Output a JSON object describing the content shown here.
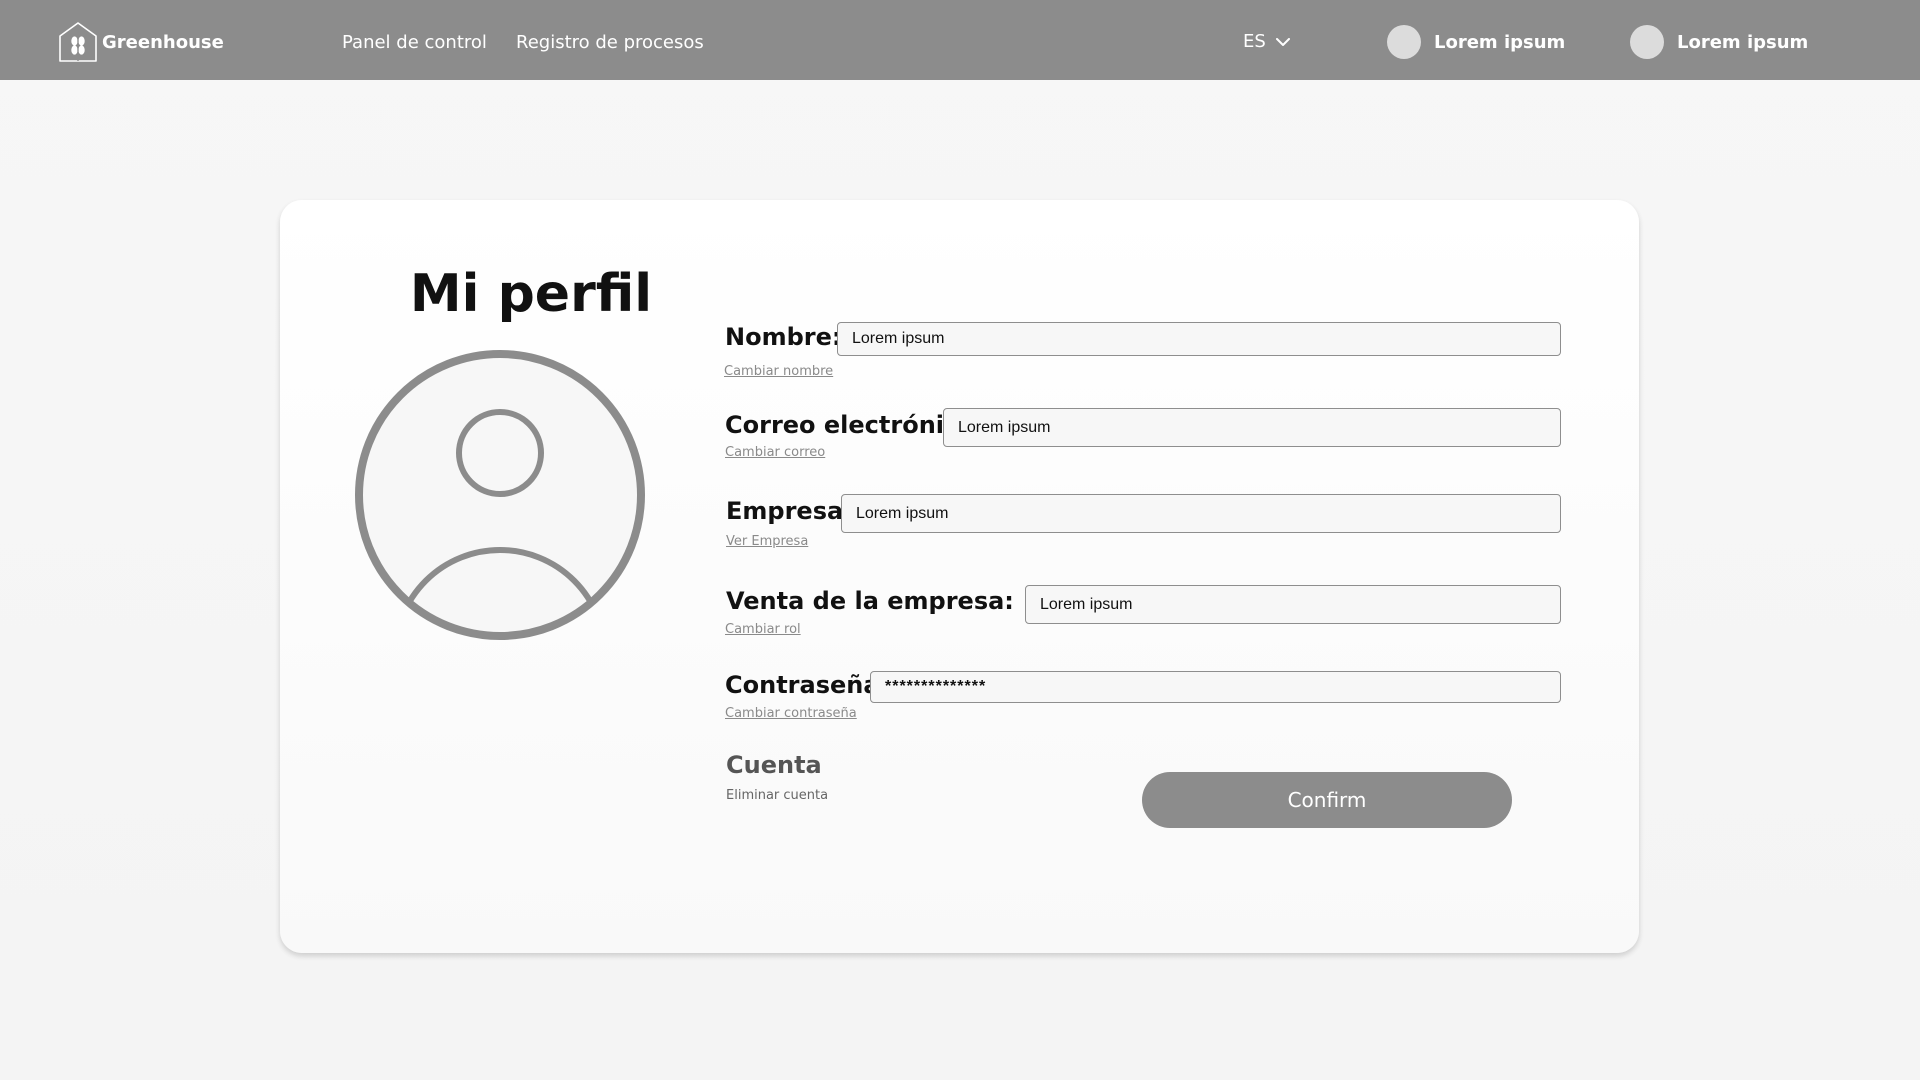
{
  "app": {
    "name": "Greenhouse",
    "logo_icon": "greenhouse-house-leaf-icon"
  },
  "nav": {
    "items": [
      {
        "label": "Panel de control"
      },
      {
        "label": "Registro de procesos"
      }
    ]
  },
  "header": {
    "language": "ES",
    "language_icon": "chevron-down-icon",
    "users": [
      {
        "name": "Lorem ipsum"
      },
      {
        "name": "Lorem ipsum"
      }
    ]
  },
  "profile": {
    "title": "Mi perfil",
    "avatar_icon": "user-avatar-icon",
    "fields": {
      "nombre": {
        "label": "Nombre:",
        "value": "Lorem ipsum",
        "link": "Cambiar nombre"
      },
      "correo": {
        "label": "Correo electrónico:",
        "value": "Lorem ipsum",
        "link": "Cambiar correo"
      },
      "empresa": {
        "label": "Empresa:",
        "value": "Lorem ipsum",
        "link": "Ver Empresa"
      },
      "venta": {
        "label": "Venta de la empresa:",
        "value": "Lorem ipsum",
        "link": "Cambiar rol"
      },
      "contrasena": {
        "label": "Contraseña:",
        "value": "**************",
        "link": "Cambiar contraseña"
      }
    },
    "account": {
      "title": "Cuenta",
      "delete_label": "Eliminar cuenta"
    },
    "confirm_label": "Confirm"
  },
  "colors": {
    "header_bg": "#8c8c8c",
    "button_bg": "#8c8c8c",
    "avatar_stroke": "#8c8c8c",
    "link_text": "#8a8a8a"
  }
}
